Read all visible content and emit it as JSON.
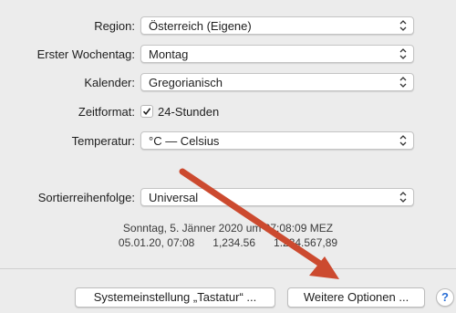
{
  "form": {
    "region": {
      "label": "Region:",
      "value": "Österreich (Eigene)"
    },
    "first_weekday": {
      "label": "Erster Wochentag:",
      "value": "Montag"
    },
    "calendar": {
      "label": "Kalender:",
      "value": "Gregorianisch"
    },
    "time_format": {
      "label": "Zeitformat:",
      "checkbox_label": "24-Stunden",
      "checked": true
    },
    "temperature": {
      "label": "Temperatur:",
      "value": "°C — Celsius"
    },
    "sort_order": {
      "label": "Sortierreihenfolge:",
      "value": "Universal"
    }
  },
  "sample": {
    "line1": "Sonntag, 5. Jänner 2020 um 07:08:09 MEZ",
    "line2": "05.01.20, 07:08      1,234.56      1.234.567,89"
  },
  "footer": {
    "keyboard_button": "Systemeinstellung „Tastatur“ ...",
    "more_options_button": "Weitere Optionen ...",
    "help_label": "?"
  },
  "colors": {
    "annotation_arrow": "#cc4a2f",
    "help_accent": "#2a6fd6"
  }
}
